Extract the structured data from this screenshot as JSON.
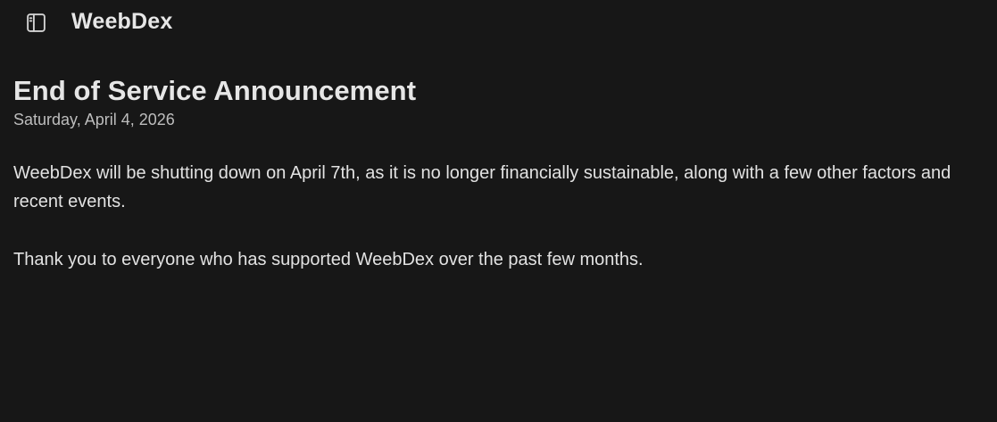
{
  "header": {
    "app_title": "WeebDex",
    "sidebar_toggle_icon": "sidebar-panel-icon"
  },
  "announcement": {
    "title": "End of Service Announcement",
    "date": "Saturday, April 4, 2026",
    "paragraphs": [
      "WeebDex will be shutting down on April 7th, as it is no longer financially sustainable, along with a few other factors and recent events.",
      "Thank you to everyone who has supported WeebDex over the past few months."
    ]
  },
  "colors": {
    "background": "#171717",
    "text": "#e6e6e6",
    "muted_text": "#bdbdbd"
  }
}
